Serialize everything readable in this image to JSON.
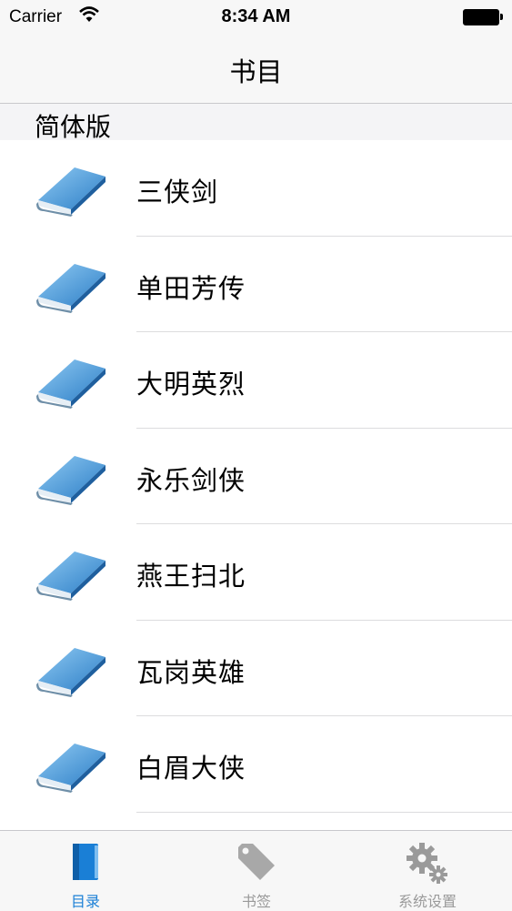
{
  "status_bar": {
    "carrier": "Carrier",
    "time": "8:34 AM"
  },
  "nav": {
    "title": "书目"
  },
  "section": {
    "title": "简体版"
  },
  "books": [
    {
      "title": "三侠剑"
    },
    {
      "title": "单田芳传"
    },
    {
      "title": "大明英烈"
    },
    {
      "title": "永乐剑侠"
    },
    {
      "title": "燕王扫北"
    },
    {
      "title": "瓦岗英雄"
    },
    {
      "title": "白眉大侠"
    }
  ],
  "tabs": [
    {
      "label": "目录",
      "icon": "book-icon",
      "active": true
    },
    {
      "label": "书签",
      "icon": "tag-icon",
      "active": false
    },
    {
      "label": "系统设置",
      "icon": "gear-icon",
      "active": false
    }
  ],
  "colors": {
    "accent": "#1a7fd6",
    "inactive": "#9a9a9a"
  }
}
